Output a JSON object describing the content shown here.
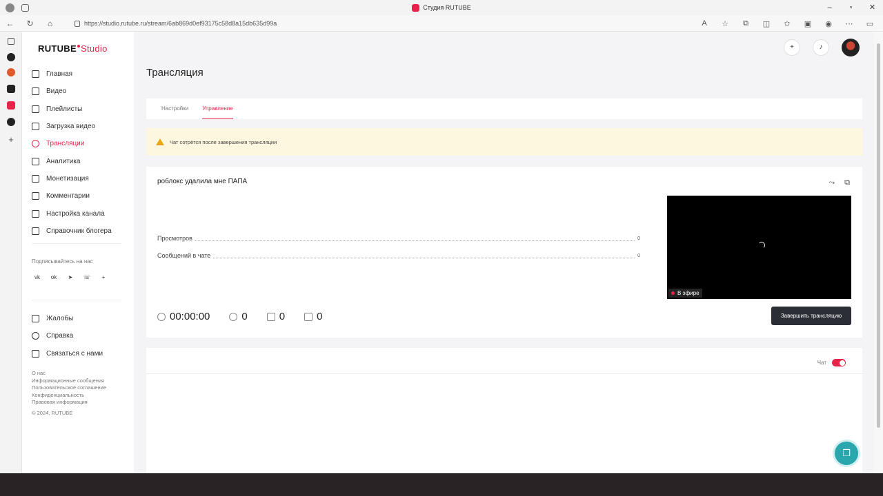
{
  "browser": {
    "tab_title": "Студия RUTUBE",
    "url": "https://studio.rutube.ru/stream/6ab869d0ef93175c58d8a15db635d99a"
  },
  "logo": {
    "main": "RUTUBE",
    "studio": "Studio"
  },
  "sidebar": {
    "items": [
      {
        "label": "Главная",
        "icon": "home-icon"
      },
      {
        "label": "Видео",
        "icon": "video-icon"
      },
      {
        "label": "Плейлисты",
        "icon": "playlist-icon"
      },
      {
        "label": "Загрузка видео",
        "icon": "upload-icon"
      },
      {
        "label": "Трансляции",
        "icon": "broadcast-icon",
        "active": true
      },
      {
        "label": "Аналитика",
        "icon": "analytics-icon"
      },
      {
        "label": "Монетизация",
        "icon": "monetization-icon"
      },
      {
        "label": "Комментарии",
        "icon": "comments-icon"
      },
      {
        "label": "Настройка канала",
        "icon": "gear-icon"
      },
      {
        "label": "Справочник блогера",
        "icon": "guide-icon"
      }
    ],
    "subscribe_label": "Подписывайтесь на нас",
    "socials": [
      "vk",
      "ok",
      "telegram",
      "viber",
      "more"
    ],
    "bottom_items": [
      {
        "label": "Жалобы",
        "icon": "flag-icon"
      },
      {
        "label": "Справка",
        "icon": "help-icon"
      },
      {
        "label": "Связаться с нами",
        "icon": "mail-icon"
      }
    ],
    "footer_links": [
      "О нас",
      "Информационные сообщения",
      "Пользовательское соглашение",
      "Конфиденциальность",
      "Правовая информация"
    ],
    "copyright": "© 2024, RUTUBE"
  },
  "page": {
    "title": "Трансляция",
    "tabs": [
      {
        "label": "Настройки",
        "active": false
      },
      {
        "label": "Управление",
        "active": true
      }
    ],
    "alert": "Чат сотрётся после завершения трансляции"
  },
  "stream": {
    "title": "роблокс удалила мне ПАПА",
    "stats": [
      {
        "label": "Просмотров",
        "value": "0"
      },
      {
        "label": "Сообщений в чате",
        "value": "0"
      }
    ],
    "live_badge": "В эфире",
    "duration": "00:00:00",
    "viewers": "0",
    "likes": "0",
    "dislikes": "0",
    "end_button": "Завершить трансляцию"
  },
  "chat": {
    "label": "Чат",
    "enabled": true
  },
  "colors": {
    "accent": "#e8234a",
    "fab": "#2aa6ad",
    "button_dark": "#2b2f35",
    "alert_bg": "#fdf7df"
  }
}
